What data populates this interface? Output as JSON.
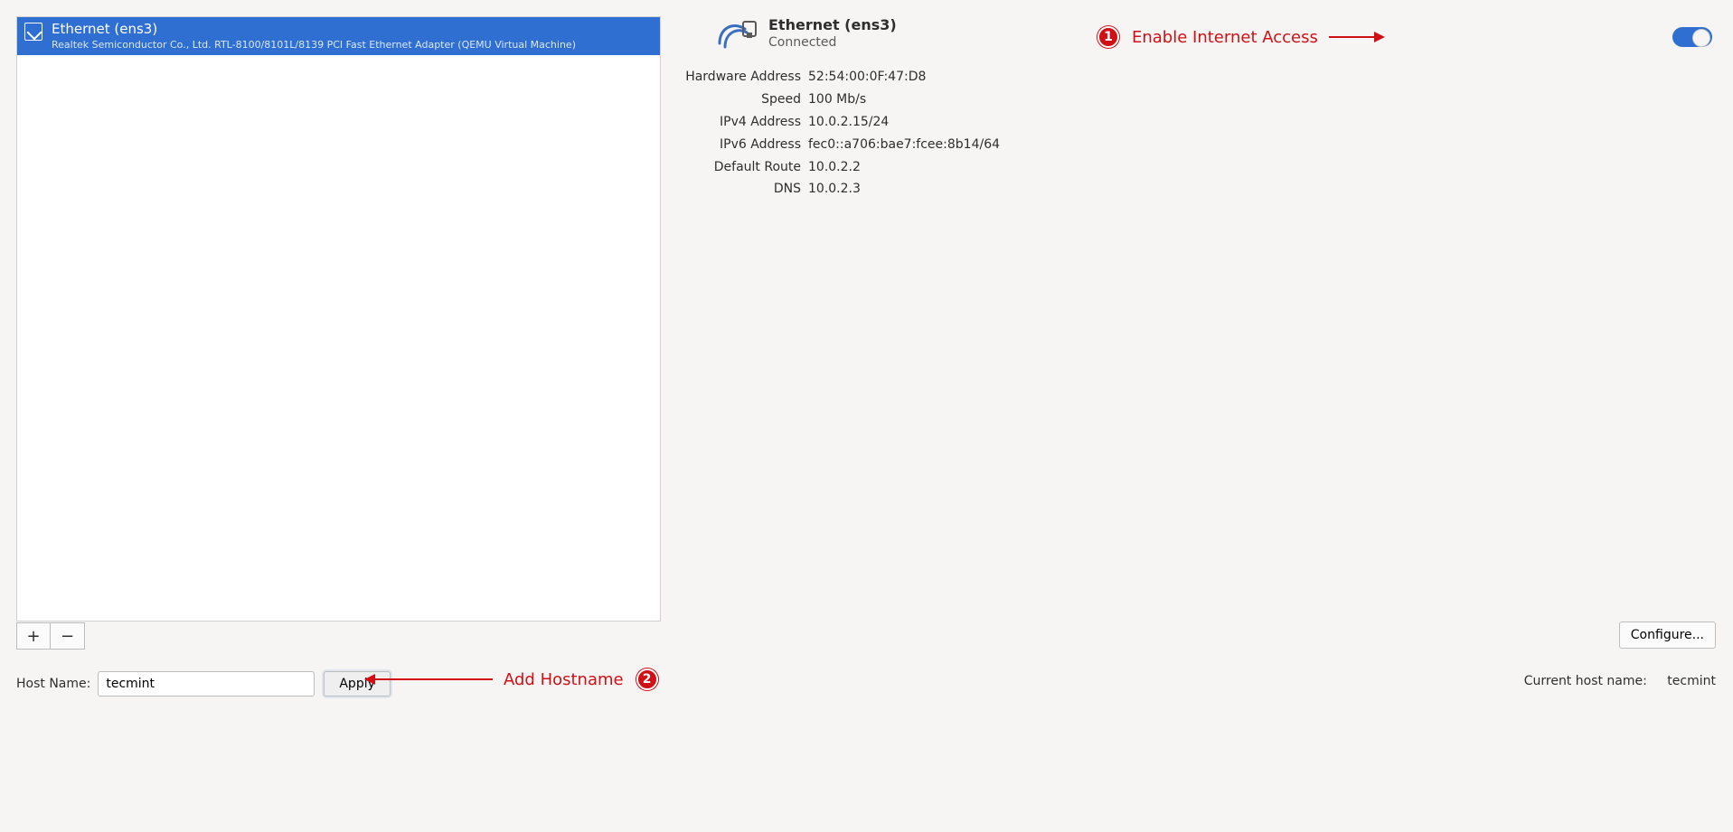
{
  "netlist": {
    "title": "Ethernet (ens3)",
    "subtitle": "Realtek Semiconductor Co., Ltd. RTL-8100/8101L/8139 PCI Fast Ethernet Adapter (QEMU Virtual Machine)"
  },
  "list_buttons": {
    "add": "+",
    "remove": "−"
  },
  "detail": {
    "title": "Ethernet (ens3)",
    "status": "Connected",
    "rows": {
      "hw_label": "Hardware Address",
      "hw_val": "52:54:00:0F:47:D8",
      "speed_label": "Speed",
      "speed_val": "100 Mb/s",
      "ip4_label": "IPv4 Address",
      "ip4_val": "10.0.2.15/24",
      "ip6_label": "IPv6 Address",
      "ip6_val": "fec0::a706:bae7:fcee:8b14/64",
      "route_label": "Default Route",
      "route_val": "10.0.2.2",
      "dns_label": "DNS",
      "dns_val": "10.0.2.3"
    }
  },
  "configure_label": "Configure...",
  "hostname": {
    "label": "Host Name:",
    "value": "tecmint",
    "apply": "Apply",
    "current_label": "Current host name:",
    "current_value": "tecmint"
  },
  "annotations": {
    "a1_text": "Enable Internet Access",
    "a1_num": "1",
    "a2_text": "Add Hostname",
    "a2_num": "2"
  }
}
